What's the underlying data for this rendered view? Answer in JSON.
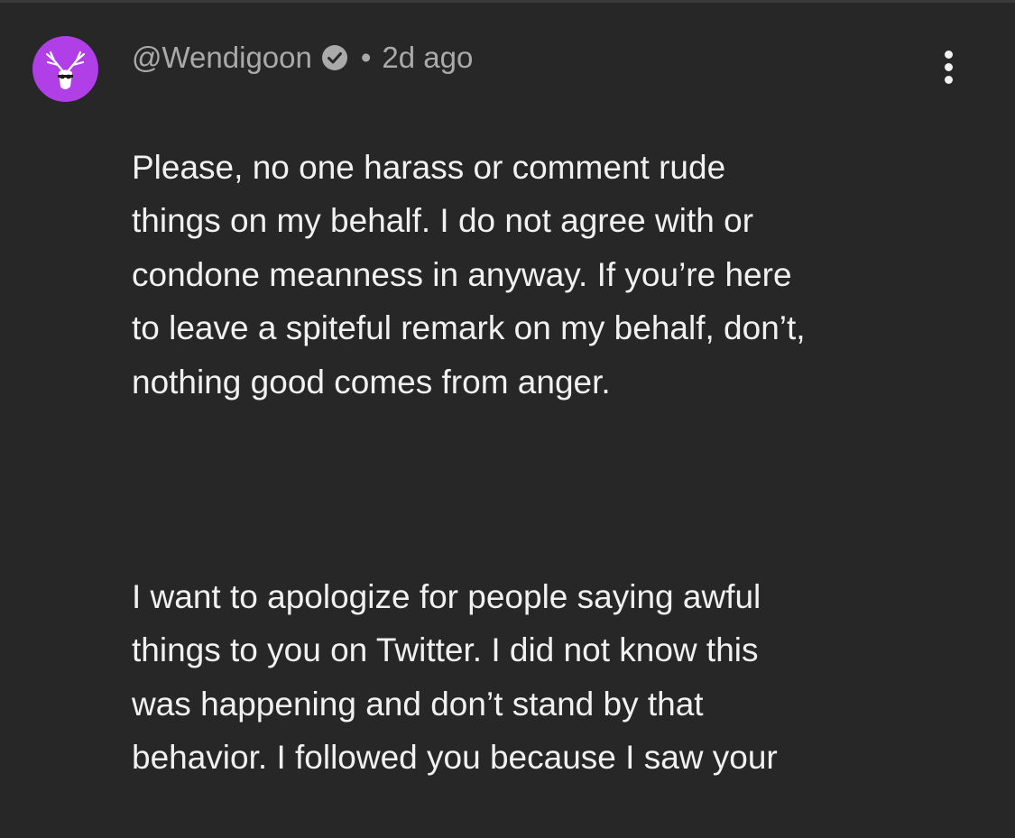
{
  "comment": {
    "author": "@Wendigoon",
    "separator": "•",
    "timestamp": "2d ago",
    "paragraphs": [
      "Please, no one harass or comment rude\nthings on my behalf. I do not agree with or\ncondone meanness in anyway. If you’re here\nto leave a spiteful remark on my behalf, don’t,\nnothing good comes from anger.",
      "I want to apologize for people saying awful\nthings to you on Twitter. I did not know this\nwas happening and don’t stand by that\nbehavior. I followed you because I saw your"
    ]
  },
  "icons": {
    "avatar": "deer-skull-avatar",
    "verified": "verified-check-icon",
    "menu": "more-vertical-icon"
  },
  "colors": {
    "background": "#272727",
    "text": "#f1f1f1",
    "meta": "#aaaaaa",
    "avatar_bg": "#b13fe8"
  }
}
